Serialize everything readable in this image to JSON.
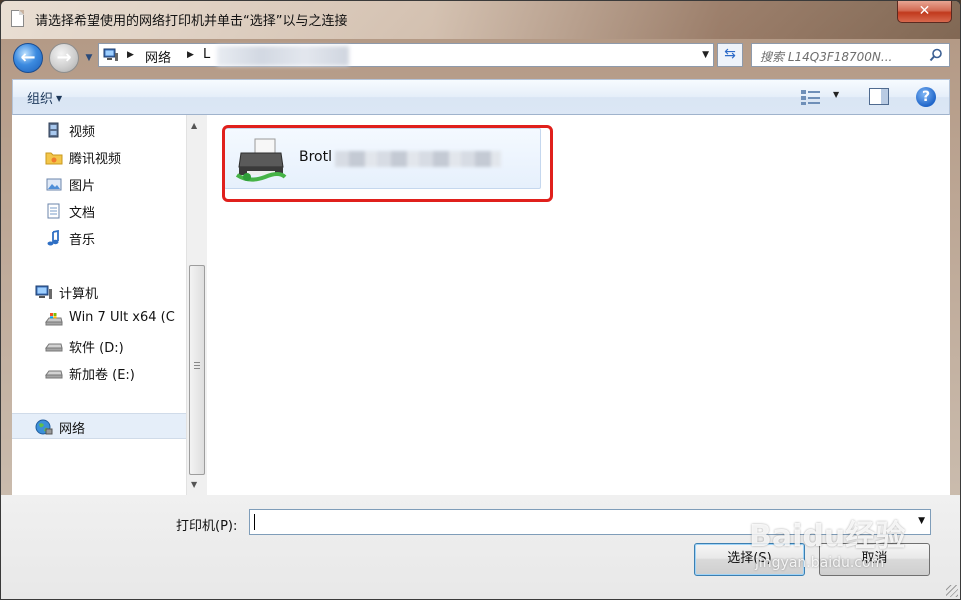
{
  "window": {
    "title": "请选择希望使用的网络打印机并单击“选择”以与之连接",
    "close_symbol": "✕"
  },
  "address_bar": {
    "segments": [
      "网络",
      "L"
    ],
    "search_placeholder": "搜索 L14Q3F18700N..."
  },
  "toolbar": {
    "organize_label": "组织",
    "help_symbol": "?"
  },
  "nav_pane": {
    "items": [
      {
        "label": "视频",
        "icon": "video-library-icon"
      },
      {
        "label": "腾讯视频",
        "icon": "folder-icon"
      },
      {
        "label": "图片",
        "icon": "pictures-library-icon"
      },
      {
        "label": "文档",
        "icon": "documents-library-icon"
      },
      {
        "label": "音乐",
        "icon": "music-library-icon"
      },
      {
        "label": "计算机",
        "icon": "computer-icon"
      },
      {
        "label": "Win 7 Ult x64 (C",
        "icon": "windows-drive-icon"
      },
      {
        "label": "软件 (D:)",
        "icon": "drive-icon"
      },
      {
        "label": "新加卷 (E:)",
        "icon": "drive-icon"
      },
      {
        "label": "网络",
        "icon": "network-globe-icon"
      }
    ]
  },
  "content": {
    "printers": [
      {
        "label": "Brotl",
        "icon": "printer-icon"
      }
    ]
  },
  "bottom": {
    "printer_field_label": "打印机(P):",
    "printer_field_value": "",
    "select_button": "选择(S)",
    "cancel_button": "取消"
  },
  "watermark": {
    "main": "Baidu经验",
    "sub": "jingyan.baidu.com"
  },
  "colors": {
    "highlight": "#e0201c",
    "selection": "#e5eef9"
  }
}
